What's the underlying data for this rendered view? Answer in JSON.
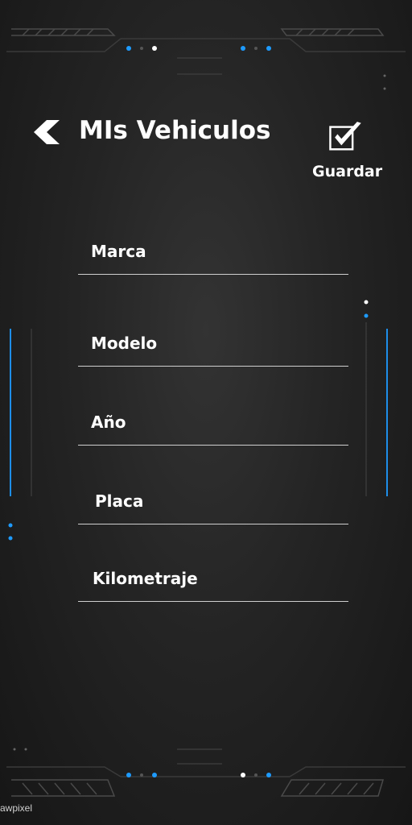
{
  "header": {
    "title": "MIs Vehiculos",
    "back_icon": "chevron-left-icon",
    "save_label": "Guardar",
    "save_icon": "checkbox-check-icon"
  },
  "form": {
    "fields": [
      {
        "label": "Marca",
        "value": ""
      },
      {
        "label": "Modelo",
        "value": ""
      },
      {
        "label": "Año",
        "value": ""
      },
      {
        "label": "Placa",
        "value": ""
      },
      {
        "label": "Kilometraje",
        "value": ""
      }
    ]
  },
  "watermark": "awpixel",
  "colors": {
    "background": "#1b1b1b",
    "accent_blue": "#1e9bff",
    "text": "#ffffff",
    "underline": "#cfcfcf"
  }
}
